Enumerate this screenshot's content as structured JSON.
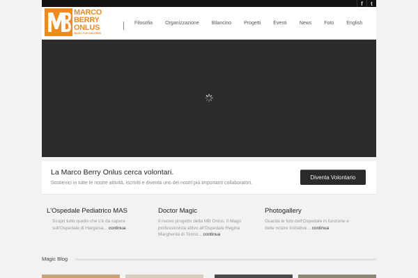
{
  "brand": {
    "line1": "Marco",
    "line2": "Berry",
    "line3": "Onlus",
    "tagline": "MAGIC FOR CHILDREN",
    "accent": "#f08a1c"
  },
  "social": [
    {
      "name": "facebook-icon",
      "glyph": "f"
    },
    {
      "name": "twitter-icon",
      "glyph": "t"
    }
  ],
  "nav": [
    "Filosofia",
    "Organizzazione",
    "Bilancino",
    "Progetti",
    "Eventi",
    "News",
    "Foto",
    "English"
  ],
  "cta": {
    "title": "La Marco Berry Onlus cerca volontari.",
    "subtitle": "Sostienici in tutte le nostre attività, iscriviti e diventa uno dei nostri più importanti collaboratori.",
    "button": "Diventa Volontario"
  },
  "features": [
    {
      "title": "L'Ospedale Pediatrico MAS",
      "text": "Scopri tutto quello che c'è da sapere sull'Ospedale di Hargeisa...",
      "more": "continua"
    },
    {
      "title": "Doctor Magic",
      "text": "Il nuovo progetto della MB Onlus. Il Mago professionista attivo all'Ospedale Regina Margherita di Torino...",
      "more": "continua"
    },
    {
      "title": "Photogallery",
      "text": "Guarda le foto dell'Ospedale in funzione e delle nostre iniziative...",
      "more": "continua"
    }
  ],
  "blog": {
    "title": "Magic Blog"
  }
}
